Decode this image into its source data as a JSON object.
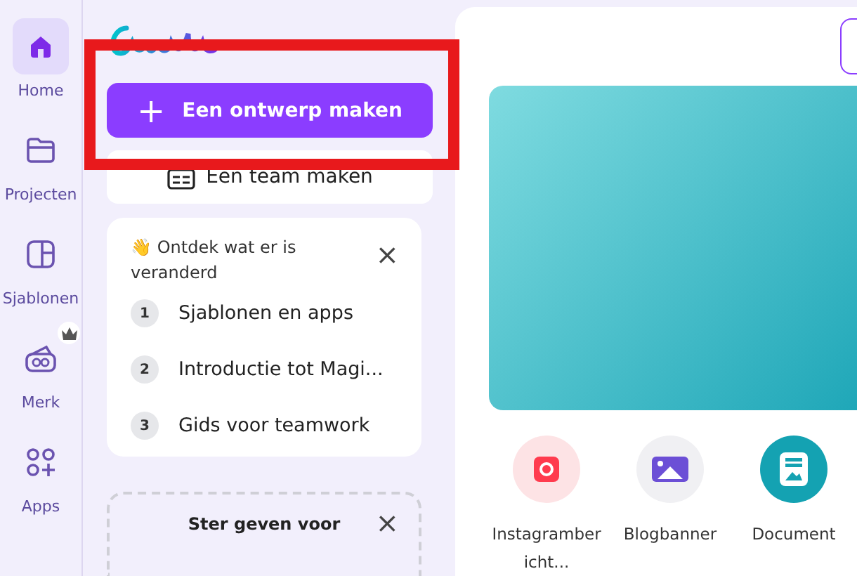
{
  "rail": [
    {
      "label": "Home",
      "kind": "home",
      "selected": true,
      "badge": false
    },
    {
      "label": "Projecten",
      "kind": "folder",
      "selected": false,
      "badge": false
    },
    {
      "label": "Sjablonen",
      "kind": "template",
      "selected": false,
      "badge": false
    },
    {
      "label": "Merk",
      "kind": "brand",
      "selected": false,
      "badge": true
    },
    {
      "label": "Apps",
      "kind": "apps",
      "selected": false,
      "badge": false
    }
  ],
  "create_button": {
    "icon": "+",
    "label": "Een ontwerp maken"
  },
  "team_button": {
    "label": "Een team maken"
  },
  "discover": {
    "emoji": "👋",
    "title": "Ontdek wat er is veranderd",
    "close": "×",
    "items": [
      {
        "number": "1",
        "label": "Sjablonen en apps"
      },
      {
        "number": "2",
        "label": "Introductie tot Magi..."
      },
      {
        "number": "3",
        "label": "Gids voor teamwork"
      }
    ]
  },
  "rating_card": {
    "title": "Ster geven voor",
    "close": "×"
  },
  "design_types": [
    {
      "label": "Instagramber icht...",
      "kind": "instagram"
    },
    {
      "label": "Blogbanner",
      "kind": "image"
    },
    {
      "label": "Document",
      "kind": "document"
    }
  ],
  "highlight": {
    "shown": true
  }
}
